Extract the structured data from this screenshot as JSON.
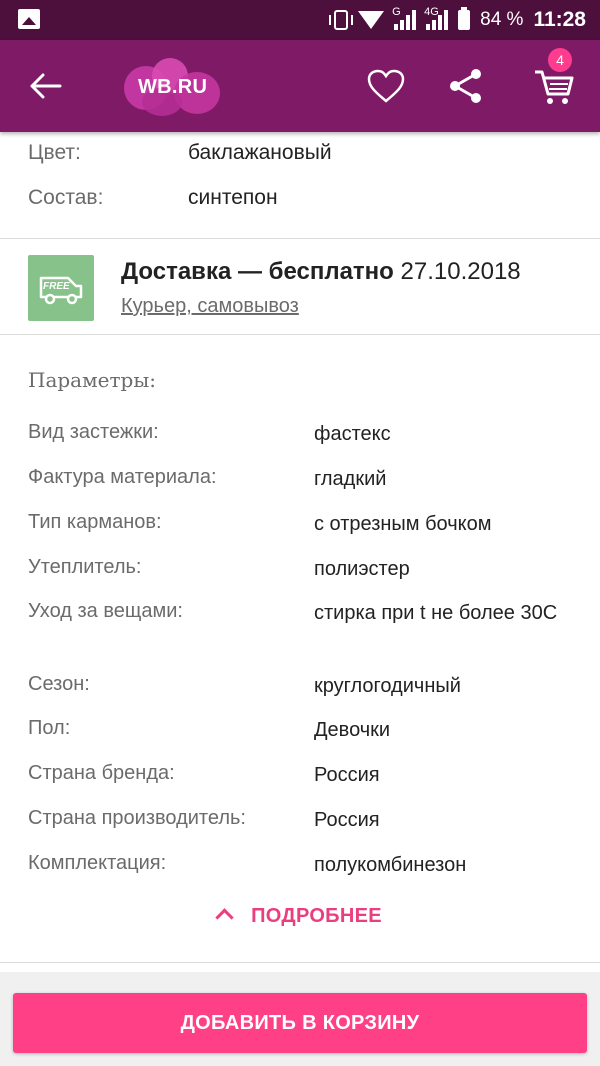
{
  "status_bar": {
    "network": "G",
    "network2": "4G",
    "battery": "84 %",
    "time": "11:28"
  },
  "app_bar": {
    "logo_text": "WB.RU",
    "cart_count": "4"
  },
  "product": {
    "color_label": "Цвет:",
    "color_value": "баклажановый",
    "composition_label": "Состав:",
    "composition_value": "синтепон"
  },
  "delivery": {
    "free_icon_text": "FREE",
    "title_bold": "Доставка — бесплатно",
    "date": "27.10.2018",
    "methods": "Курьер, самовывоз"
  },
  "parameters": {
    "title": "Параметры:",
    "rows": [
      {
        "label": "Вид застежки:",
        "value": "фастекс"
      },
      {
        "label": "Фактура материала:",
        "value": "гладкий"
      },
      {
        "label": "Тип карманов:",
        "value": "с отрезным бочком"
      },
      {
        "label": "Утеплитель:",
        "value": "полиэстер"
      },
      {
        "label": "Уход за вещами:",
        "value": "стирка при t не более 30С"
      },
      {
        "label": "Сезон:",
        "value": "круглогодичный"
      },
      {
        "label": "Пол:",
        "value": "Девочки"
      },
      {
        "label": "Страна бренда:",
        "value": "Россия"
      },
      {
        "label": "Страна производитель:",
        "value": "Россия"
      },
      {
        "label": "Комплектация:",
        "value": "полукомбинезон"
      }
    ],
    "more_label": "ПОДРОБНЕЕ"
  },
  "actions": {
    "add_to_cart": "ДОБАВИТЬ В КОРЗИНУ"
  },
  "colors": {
    "app_bar": "#7f1a66",
    "status_bar": "#4d0f3c",
    "accent": "#ff3f86",
    "free_badge": "#86c28a"
  }
}
